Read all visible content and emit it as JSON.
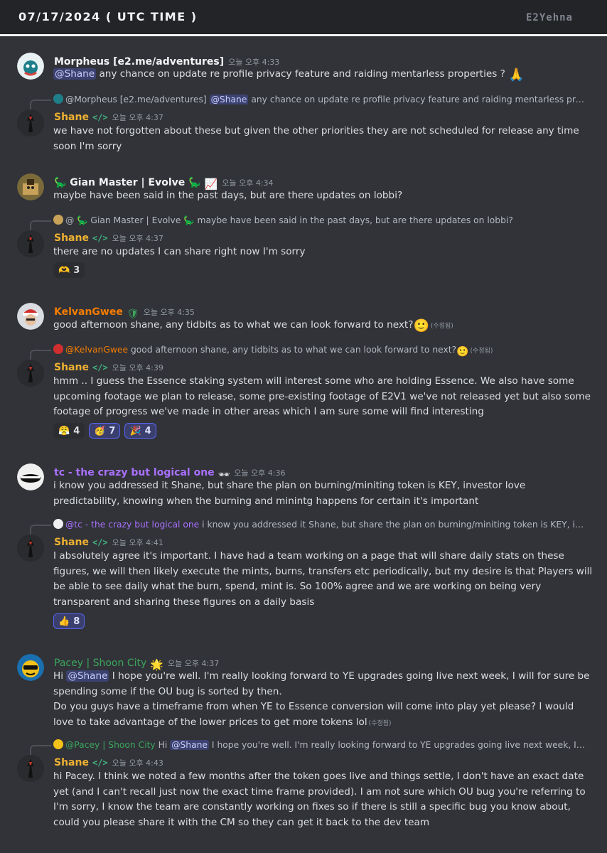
{
  "header": {
    "date": "07/17/2024 ( UTC TIME )",
    "brand": "E2Yehna"
  },
  "colors": {
    "shane": "#f0b232",
    "kelvan": "#f47b00",
    "tc": "#a970ff",
    "pacey": "#3ba55d",
    "mention_bg": "#3c4270"
  },
  "messages": [
    {
      "author": "Morpheus [e2.me/adventures]",
      "time": "오늘 오후 4:33",
      "mention": "@Shane",
      "text": " any chance on update re profile privacy feature and raiding mentarless properties ?",
      "emoji": "🙏"
    },
    {
      "reply_author": "@Morpheus [e2.me/adventures]",
      "reply_mention": "@Shane",
      "reply_text": " any chance on update re profile privacy feature and raiding mentarless properti...",
      "author": "Shane",
      "tag": "</>",
      "time": "오늘 오후 4:37",
      "text": "we have not forgotten about these but given the other priorities they are not scheduled for release any time soon I'm sorry"
    },
    {
      "author": "🦕 Gian Master | Evolve 🦕",
      "badge": "📈",
      "time": "오늘 오후 4:34",
      "text": "maybe have been said in the past days, but are there updates on lobbi?"
    },
    {
      "reply_author": "@ 🦕 Gian Master | Evolve 🦕",
      "reply_text": " maybe have been said in the past days, but are there updates on lobbi?",
      "author": "Shane",
      "tag": "</>",
      "time": "오늘 오후 4:37",
      "text": "there are no updates I can share right now I'm sorry",
      "reactions": [
        {
          "emoji": "🫶",
          "count": "3",
          "active": false
        }
      ]
    },
    {
      "author": "KelvanGwee",
      "badge": "🛡",
      "time": "오늘 오후 4:35",
      "text": "good afternoon shane, any tidbits as to what we can look forward to next?",
      "emoji": "🙂",
      "edited": "(수정됨)"
    },
    {
      "reply_author": "@KelvanGwee",
      "reply_text": " good afternoon shane, any tidbits as to what we can look forward to next?",
      "reply_emoji": "🙂",
      "reply_edited": "(수정됨)",
      "author": "Shane",
      "tag": "</>",
      "time": "오늘 오후 4:39",
      "text": "hmm .. I guess the Essence staking system will interest some who are holding Essence. We also have some upcoming footage we plan to release, some pre-existing footage of E2V1 we've not released yet but also some footage of progress we've made in other areas which I am sure some will find interesting",
      "reactions": [
        {
          "emoji": "😤",
          "count": "4",
          "active": false
        },
        {
          "emoji": "🥳",
          "count": "7",
          "active": true
        },
        {
          "emoji": "🎉",
          "count": "4",
          "active": true
        }
      ]
    },
    {
      "author": "tc  - the crazy but logical one",
      "badge": "🕶",
      "time": "오늘 오후 4:36",
      "text": "i know you addressed it  Shane, but share the plan on burning/miniting token is KEY, investor love predictability, knowing when the burning and minintg happens for certain it's important"
    },
    {
      "reply_author": "@tc  - the crazy but logical one",
      "reply_text": " i know you addressed it  Shane, but share the plan on burning/miniting token is KEY, invest...",
      "author": "Shane",
      "tag": "</>",
      "time": "오늘 오후 4:41",
      "text": "I absolutely agree it's important. I have had a team working on a page that will share daily stats on these figures, we will then likely execute the mints, burns, transfers etc periodically, but my desire is that Players will be able to see daily what the burn, spend, mint is. So 100% agree and we are working on being very transparent and sharing these figures on a daily basis",
      "reactions": [
        {
          "emoji": "👍",
          "count": "8",
          "active": true
        }
      ]
    },
    {
      "author": "Pacey | Shoon City",
      "badge": "🌟",
      "time": "오늘 오후 4:37",
      "pre": "Hi ",
      "mention": "@Shane",
      "text": " I hope you're well. I'm really looking forward to YE upgrades going live next week, I will for sure be spending some if the OU bug is sorted by then.",
      "text2": "Do you guys have a timeframe from when YE to Essence conversion will come into play yet please? I would love to take advantage of the lower prices to get more tokens lol",
      "edited": "(수정됨)"
    },
    {
      "reply_author": "@Pacey | Shoon City",
      "reply_pre": " Hi ",
      "reply_mention": "@Shane",
      "reply_text": " I hope you're well. I'm really looking forward to YE upgrades going live next week, I will for...",
      "author": "Shane",
      "tag": "</>",
      "time": "오늘 오후 4:43",
      "text": "hi Pacey. I think we noted a few months after the token goes live and things settle, I don't have an exact date yet (and I can't recall just now the exact time frame provided).  I am not sure which OU bug you're referring to I'm sorry, I know the team are constantly working on fixes so if there is still a specific bug you know about, could you please share it with the CM so they can get it back to the dev team"
    }
  ]
}
